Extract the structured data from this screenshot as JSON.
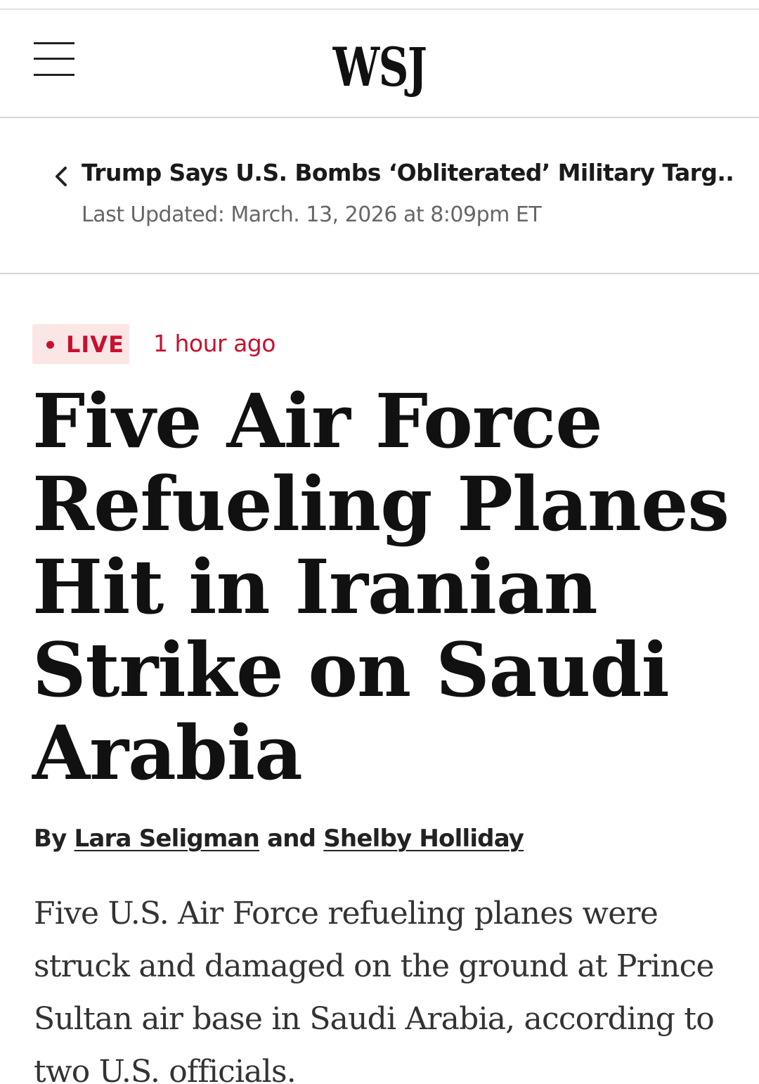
{
  "header": {
    "logo": "WSJ",
    "menu_icon": "hamburger-menu-icon"
  },
  "back_nav": {
    "icon": "chevron-left-icon",
    "parent_title": "Trump Says U.S. Bombs ‘Obliterated’ Military Targ...",
    "last_updated": "Last Updated: March. 13, 2026 at 8:09pm ET"
  },
  "article": {
    "live_label": "LIVE",
    "time_ago": "1 hour ago",
    "headline": "Five Air Force Refueling Planes Hit in Iranian Strike on Saudi Arabia",
    "byline": {
      "prefix": "By",
      "author1": "Lara Seligman",
      "conjunction": "and",
      "author2": "Shelby Holliday"
    },
    "body": "Five U.S. Air Force refueling planes were struck and damaged on the ground at Prince Sultan air base in Saudi Arabia, according to two U.S. officials."
  },
  "colors": {
    "live_red": "#c8102e",
    "live_badge_bg": "#fbe6e6",
    "text": "#111111",
    "muted": "#666666"
  }
}
